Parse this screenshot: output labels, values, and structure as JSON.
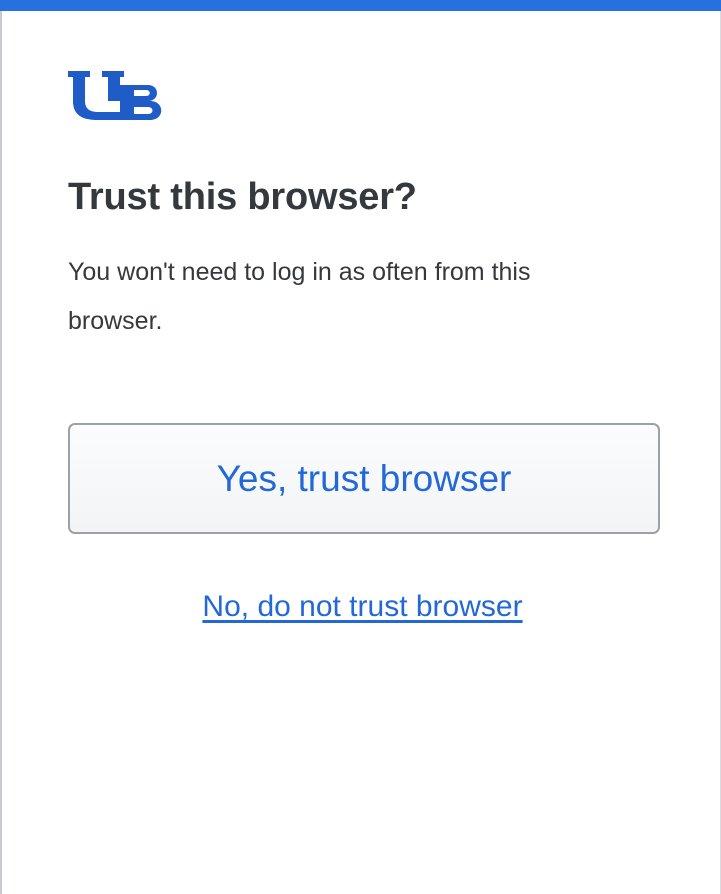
{
  "header": {
    "accent_color": "#2670df",
    "logo_icon": "ub-logo-icon"
  },
  "dialog": {
    "title": "Trust this browser?",
    "description": "You won't need to log in as often from this browser.",
    "trust_button_label": "Yes, trust browser",
    "no_trust_link_label": "No, do not trust browser"
  },
  "colors": {
    "text": "#33393d",
    "link": "#2268d8",
    "logo": "#1f5cc7"
  }
}
